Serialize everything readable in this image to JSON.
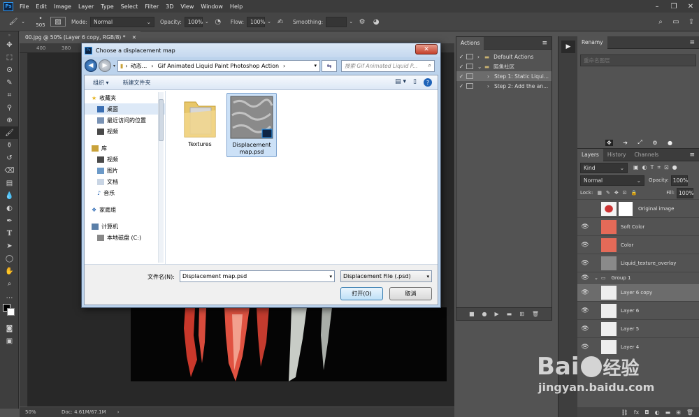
{
  "menubar": {
    "logo": "Ps",
    "items": [
      "File",
      "Edit",
      "Image",
      "Layer",
      "Type",
      "Select",
      "Filter",
      "3D",
      "View",
      "Window",
      "Help"
    ]
  },
  "optionsbar": {
    "brush_size": "505",
    "mode_label": "Mode:",
    "mode_value": "Normal",
    "opacity_label": "Opacity:",
    "opacity_value": "100%",
    "flow_label": "Flow:",
    "flow_value": "100%",
    "smoothing_label": "Smoothing:"
  },
  "document": {
    "tab_title": "00.jpg @ 50% (Layer 6 copy, RGB/8) *",
    "ruler_marks": [
      "400",
      "380"
    ],
    "zoom": "50%",
    "doc_info": "Doc: 4.61M/67.1M"
  },
  "actions_panel": {
    "tab": "Actions",
    "rows": [
      {
        "label": "Default Actions",
        "level": 0
      },
      {
        "label": "陌鱼社区",
        "level": 0
      },
      {
        "label": "Step 1: Static Liqui...",
        "level": 1
      },
      {
        "label": "Step 2: Add the an...",
        "level": 1
      }
    ]
  },
  "renamy_panel": {
    "tab": "Renamy",
    "placeholder": "重命名图层"
  },
  "layers_panel": {
    "tabs": [
      "Layers",
      "History",
      "Channels"
    ],
    "kind_label": "Kind",
    "blend_mode": "Normal",
    "opacity_label": "Opacity:",
    "opacity_value": "100%",
    "lock_label": "Lock:",
    "fill_label": "Fill:",
    "fill_value": "100%",
    "layers": [
      {
        "name": "Original image",
        "visible": false
      },
      {
        "name": "Soft Color",
        "visible": true
      },
      {
        "name": "Color",
        "visible": true
      },
      {
        "name": "Liquid_texture_overlay",
        "visible": true
      },
      {
        "name": "Group 1",
        "visible": true
      },
      {
        "name": "Layer 6 copy",
        "visible": true
      },
      {
        "name": "Layer 6",
        "visible": true
      },
      {
        "name": "Layer 5",
        "visible": true
      },
      {
        "name": "Layer 4",
        "visible": true
      }
    ]
  },
  "dialog": {
    "title": "Choose a displacement map",
    "breadcrumb": [
      "动态...",
      "Gif Animated Liquid Paint Photoshop Action"
    ],
    "search_placeholder": "搜索 Gif Animated Liquid P...",
    "organize": "组织 ▾",
    "new_folder": "新建文件夹",
    "nav": {
      "favorites": "收藏夹",
      "desktop": "桌面",
      "recent": "最近访问的位置",
      "videos_fav": "视频",
      "library": "库",
      "videos": "视频",
      "pictures": "图片",
      "documents": "文档",
      "music": "音乐",
      "homegroup": "家庭组",
      "computer": "计算机",
      "local_disk": "本地磁盘 (C:)"
    },
    "files": [
      {
        "name": "Textures",
        "type": "folder"
      },
      {
        "name": "Displacement map.psd",
        "type": "psd"
      }
    ],
    "filename_label": "文件名(N):",
    "filename_value": "Displacement map.psd",
    "filetype_value": "Displacement File (.psd)",
    "open_button": "打开(O)",
    "cancel_button": "取消"
  },
  "watermark": {
    "brand": "Bai",
    "brand_cn": "经验",
    "url": "jingyan.baidu.com"
  }
}
